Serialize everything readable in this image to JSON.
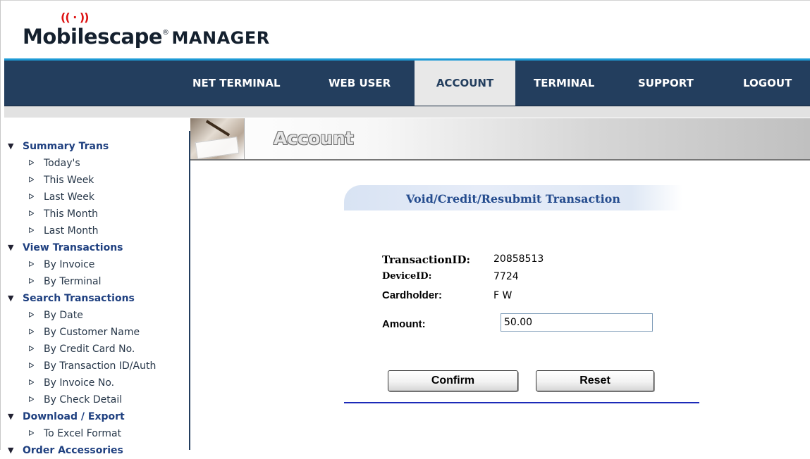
{
  "brand": {
    "name": "Mobilescape",
    "registered": "®",
    "product": "MANAGER"
  },
  "nav": {
    "items": [
      {
        "label": "NET TERMINAL"
      },
      {
        "label": "WEB USER"
      },
      {
        "label": "ACCOUNT",
        "active": true
      },
      {
        "label": "TERMINAL"
      },
      {
        "label": "SUPPORT"
      },
      {
        "label": "LOGOUT"
      }
    ]
  },
  "sidebar": {
    "sections": [
      {
        "label": "Summary Trans",
        "items": [
          "Today's",
          "This Week",
          "Last Week",
          "This Month",
          "Last Month"
        ]
      },
      {
        "label": "View Transactions",
        "items": [
          "By Invoice",
          "By Terminal"
        ]
      },
      {
        "label": "Search Transactions",
        "items": [
          "By Date",
          "By Customer Name",
          "By Credit Card No.",
          "By Transaction ID/Auth",
          "By Invoice No.",
          "By Check Detail"
        ]
      },
      {
        "label": "Download / Export",
        "items": [
          "To Excel Format"
        ]
      },
      {
        "label": "Order Accessories",
        "items": []
      }
    ]
  },
  "banner": {
    "title": "Account"
  },
  "form": {
    "heading": "Void/Credit/Resubmit Transaction",
    "transaction_id_label": "TransactionID:",
    "transaction_id": "20858513",
    "device_id_label": "DeviceID:",
    "device_id": "7724",
    "cardholder_label": "Cardholder:",
    "cardholder": "F W",
    "amount_label": "Amount:",
    "amount": "50.00",
    "confirm_label": "Confirm",
    "reset_label": "Reset"
  },
  "colors": {
    "navbar": "#233e5e",
    "accent_line": "#1d9ad6",
    "active_tab": "#e8e8e8",
    "sidebar_section": "#1f4080",
    "form_heading": "#254c8e",
    "bottom_rule": "#1c2ab8"
  }
}
